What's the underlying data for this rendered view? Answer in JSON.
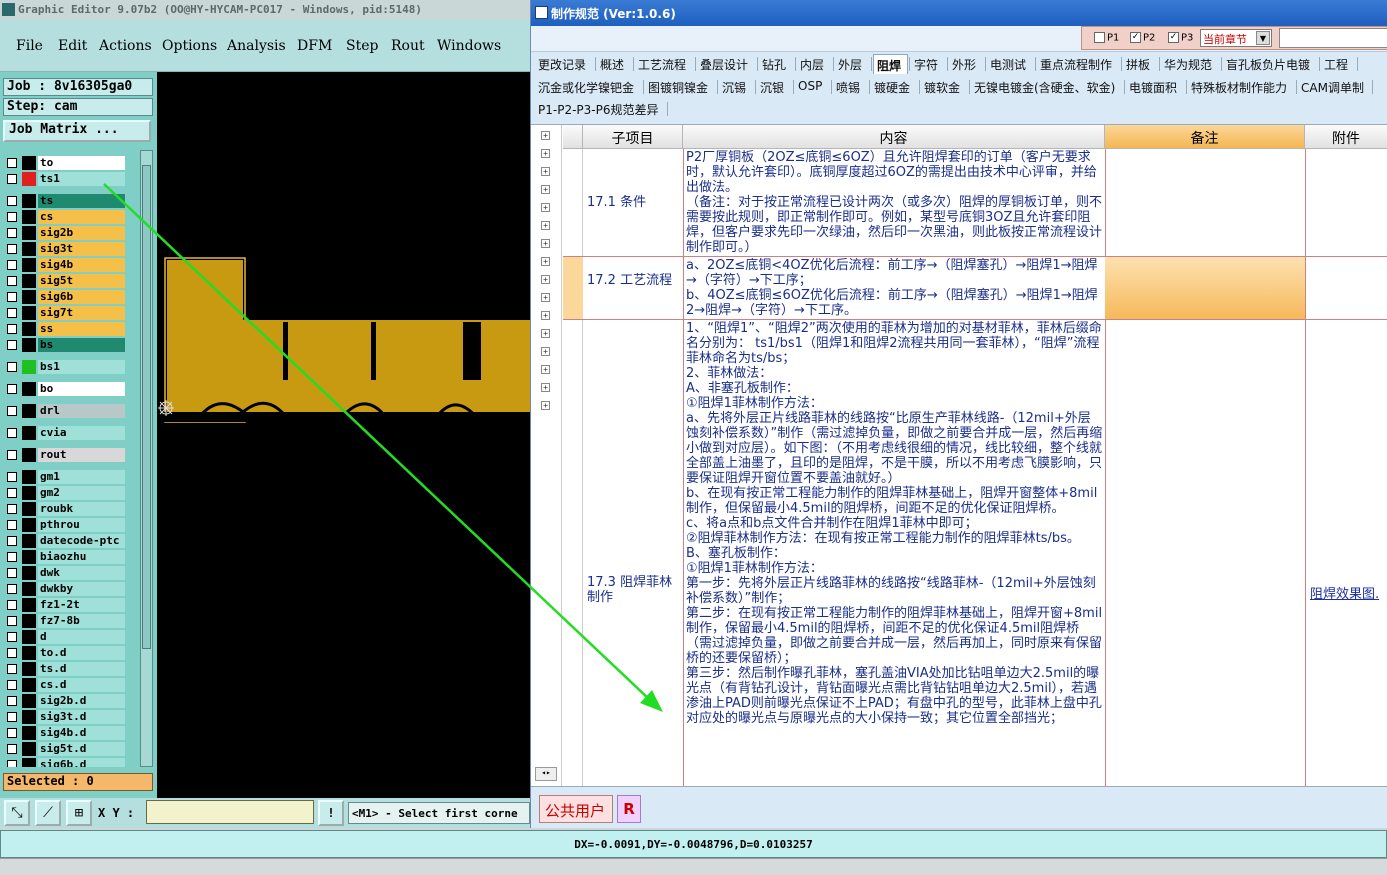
{
  "editor": {
    "title": "Graphic Editor 9.07b2 (OO@HY-HYCAM-PC017 - Windows, pid:5148)",
    "menu": [
      "File",
      "Edit",
      "Actions",
      "Options",
      "Analysis",
      "DFM",
      "Step",
      "Rout",
      "Windows"
    ],
    "job": "Job : 8v16305ga0",
    "step": "Step: cam",
    "job_matrix": "Job Matrix ...",
    "layers": [
      {
        "name": "to",
        "bg": "#ffffff"
      },
      {
        "name": "ts1",
        "bg": "#9fe0d8"
      },
      {
        "name": "ts",
        "bg": "#1f8a70"
      },
      {
        "name": "cs",
        "bg": "#f5c04a"
      },
      {
        "name": "sig2b",
        "bg": "#f5c04a"
      },
      {
        "name": "sig3t",
        "bg": "#f5c04a"
      },
      {
        "name": "sig4b",
        "bg": "#f5c04a"
      },
      {
        "name": "sig5t",
        "bg": "#f5c04a"
      },
      {
        "name": "sig6b",
        "bg": "#f5c04a"
      },
      {
        "name": "sig7t",
        "bg": "#f5c04a"
      },
      {
        "name": "ss",
        "bg": "#f5c04a"
      },
      {
        "name": "bs",
        "bg": "#1f8a70"
      },
      {
        "name": "bs1",
        "bg": "#9fe0d8"
      },
      {
        "name": "bo",
        "bg": "#ffffff"
      },
      {
        "name": "drl",
        "bg": "#b8c8c8"
      },
      {
        "name": "cvia",
        "bg": "#9fe0d8"
      },
      {
        "name": "rout",
        "bg": "#d8d8d8"
      },
      {
        "name": "gm1",
        "bg": "#9fe0d8"
      },
      {
        "name": "gm2",
        "bg": "#9fe0d8"
      },
      {
        "name": "roubk",
        "bg": "#9fe0d8"
      },
      {
        "name": "pthrou",
        "bg": "#9fe0d8"
      },
      {
        "name": "datecode-ptc",
        "bg": "#9fe0d8"
      },
      {
        "name": "biaozhu",
        "bg": "#9fe0d8"
      },
      {
        "name": "dwk",
        "bg": "#9fe0d8"
      },
      {
        "name": "dwkby",
        "bg": "#9fe0d8"
      },
      {
        "name": "fz1-2t",
        "bg": "#9fe0d8"
      },
      {
        "name": "fz7-8b",
        "bg": "#9fe0d8"
      },
      {
        "name": "d",
        "bg": "#9fe0d8"
      },
      {
        "name": "to.d",
        "bg": "#9fe0d8"
      },
      {
        "name": "ts.d",
        "bg": "#9fe0d8"
      },
      {
        "name": "cs.d",
        "bg": "#9fe0d8"
      },
      {
        "name": "sig2b.d",
        "bg": "#9fe0d8"
      },
      {
        "name": "sig3t.d",
        "bg": "#9fe0d8"
      },
      {
        "name": "sig4b.d",
        "bg": "#9fe0d8"
      },
      {
        "name": "sig5t.d",
        "bg": "#9fe0d8"
      },
      {
        "name": "sig6b.d",
        "bg": "#9fe0d8"
      }
    ],
    "selected": "Selected : 0",
    "xy_label": "X Y :",
    "prompt": "<M1> - Select first corne",
    "excl": "!",
    "status": "DX=-0.0091,DY=-0.0048796,D=0.0103257"
  },
  "spec": {
    "title": "制作规范 (Ver:1.0.6)",
    "filters": {
      "p1": "P1",
      "p2": "P2",
      "p3": "P3",
      "p2_checked": "✓",
      "p3_checked": "✓"
    },
    "chapter_select": "当前章节",
    "tabs_row1": [
      "更改记录",
      "概述",
      "工艺流程",
      "叠层设计",
      "钻孔",
      "内层",
      "外层",
      "阻焊",
      "字符",
      "外形",
      "电测试",
      "重点流程制作",
      "拼板",
      "华为规范",
      "盲孔板负片电镀",
      "工程"
    ],
    "tabs_row2": [
      "沉金或化学镍钯金",
      "图镀铜镍金",
      "沉锡",
      "沉银",
      "OSP",
      "喷锡",
      "镀硬金",
      "镀软金",
      "无镍电镀金(含硬金、软金)",
      "电镀面积",
      "特殊板材制作能力",
      "CAM调单制"
    ],
    "tabs_row3": [
      "P1-P2-P3-P6规范差异"
    ],
    "headers": {
      "sub": "子项目",
      "content": "内容",
      "note": "备注",
      "attach": "附件"
    },
    "rows": [
      {
        "sub": "17.1 条件",
        "content": "P2厂厚铜板（2OZ≤底铜≤6OZ）且允许阻焊套印的订单（客户无要求时，默认允许套印）。底铜厚度超过6OZ的需提出由技术中心评审，并给出做法。\n（备注：对于按正常流程已设计两次（或多次）阻焊的厚铜板订单，则不需要按此规则，即正常制作即可。例如，某型号底铜3OZ且允许套印阻焊，但客户要求先印一次绿油，然后印一次黑油，则此板按正常流程设计制作即可。）"
      },
      {
        "sub": "17.2 工艺流程",
        "content": "a、2OZ≤底铜<4OZ优化后流程：前工序→（阻焊塞孔）→阻焊1→阻焊→（字符）→下工序；\nb、4OZ≤底铜≤6OZ优化后流程：前工序→（阻焊塞孔）→阻焊1→阻焊2→阻焊→（字符）→下工序。"
      },
      {
        "sub": "17.3 阻焊菲林制作",
        "content": "1、“阻焊1”、“阻焊2”两次使用的菲林为增加的对基材菲林，菲林后缀命名分别为： ts1/bs1（阻焊1和阻焊2流程共用同一套菲林），“阻焊”流程菲林命名为ts/bs；\n2、菲林做法：\nA、非塞孔板制作：\n①阻焊1菲林制作方法：\na、先将外层正片线路菲林的线路按“比原生产菲林线路-（12mil+外层蚀刻补偿系数）”制作（需过滤掉负量，即做之前要合并成一层，然后再缩小做到对应层）。如下图：（不用考虑线很细的情况，线比较细，整个线就全部盖上油墨了，且印的是阻焊，不是干膜，所以不用考虑飞膜影响，只要保证阻焊开窗位置不要盖油就好。）\nb、在现有按正常工程能力制作的阻焊菲林基础上，阻焊开窗整体+8mil制作，但保留最小4.5mil的阻焊桥，间距不足的优化保证阻焊桥。\nc、将a点和b点文件合并制作在阻焊1菲林中即可；\n②阻焊菲林制作方法：在现有按正常工程能力制作的阻焊菲林ts/bs。\nB、塞孔板制作：\n①阻焊1菲林制作方法：\n第一步：先将外层正片线路菲林的线路按“线路菲林-（12mil+外层蚀刻补偿系数）”制作；\n第二步：在现有按正常工程能力制作的阻焊菲林基础上，阻焊开窗+8mil制作，保留最小4.5mil的阻焊桥，间距不足的优化保证4.5mil阻焊桥（需过滤掉负量，即做之前要合并成一层，然后再加上，同时原来有保留桥的还要保留桥）；\n第三步：然后制作曝孔菲林，塞孔盖油VIA处加比钻咀单边大2.5mil的曝光点（有背钻孔设计，背钻面曝光点需比背钻钻咀单边大2.5mil），若遇渗油上PAD则前曝光点保证不上PAD；有盘中孔的型号，此菲林上盘中孔对应处的曝光点与原曝光点的大小保持一致；其它位置全部挡光；",
        "attach": "阻焊效果图."
      }
    ],
    "footer": {
      "user": "公共用户",
      "r": "R"
    }
  }
}
